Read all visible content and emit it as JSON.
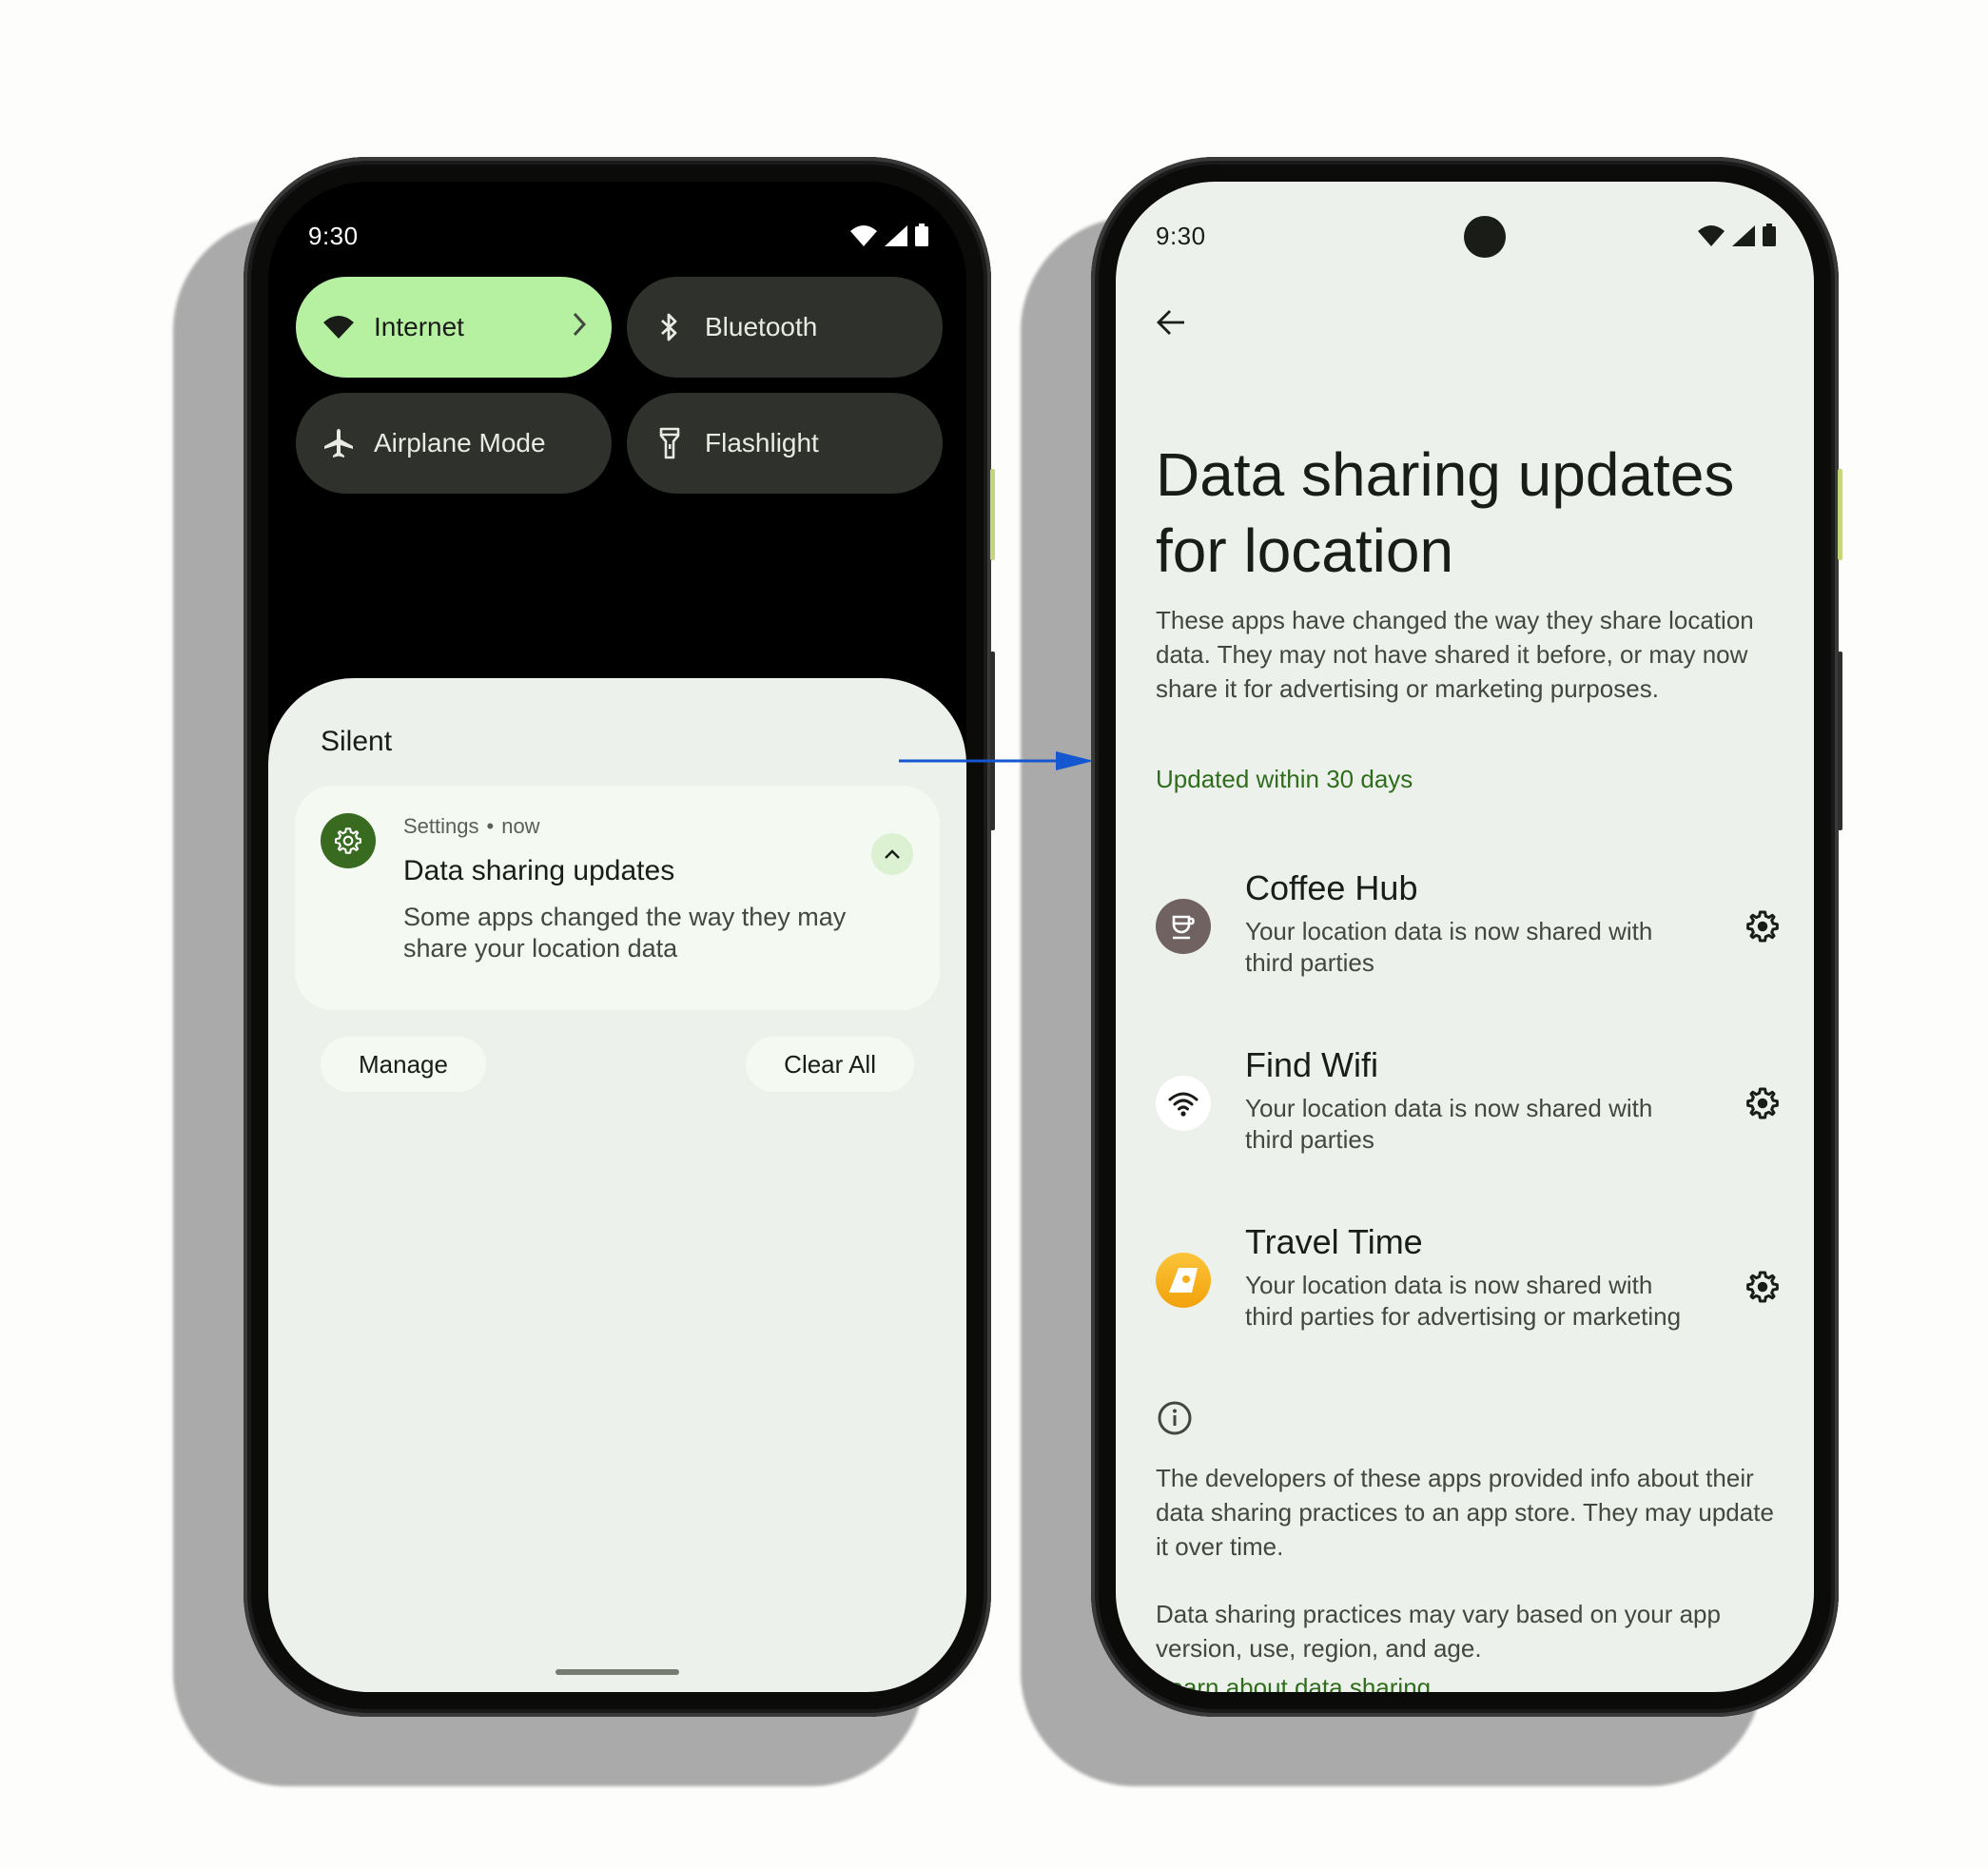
{
  "colors": {
    "accent_green": "#386a20",
    "tile_active": "#b6f0a1",
    "tile_inactive": "#2f312d",
    "surface": "#edf1eb",
    "arrow_blue": "#1557d0"
  },
  "left_phone": {
    "status_bar": {
      "time": "9:30",
      "icons": [
        "wifi-icon",
        "signal-icon",
        "battery-icon"
      ]
    },
    "quick_settings": [
      {
        "label": "Internet",
        "icon": "wifi-icon",
        "active": true,
        "has_chevron": true
      },
      {
        "label": "Bluetooth",
        "icon": "bluetooth-icon",
        "active": false
      },
      {
        "label": "Airplane Mode",
        "icon": "airplane-icon",
        "active": false
      },
      {
        "label": "Flashlight",
        "icon": "flashlight-icon",
        "active": false
      }
    ],
    "shade": {
      "section_title": "Silent",
      "notification": {
        "app": "Settings",
        "separator": "•",
        "time": "now",
        "title": "Data sharing updates",
        "body": "Some apps changed the way they may share your location data",
        "icon": "gear-icon"
      },
      "manage_label": "Manage",
      "clear_all_label": "Clear All"
    }
  },
  "right_phone": {
    "status_bar": {
      "time": "9:30",
      "icons": [
        "wifi-icon",
        "signal-icon",
        "battery-icon"
      ]
    },
    "back_icon": "arrow-back-icon",
    "title": "Data sharing updates for location",
    "description": "These apps have changed the way they share location data. They may not have shared it before, or may now share it for advertising or marketing purposes.",
    "section_label": "Updated within 30 days",
    "apps": [
      {
        "name": "Coffee Hub",
        "description": "Your location data is now shared with third parties",
        "icon": "coffee-cup-icon",
        "icon_color": "#6f6260"
      },
      {
        "name": "Find Wifi",
        "description": "Your location data is now shared with third parties",
        "icon": "wifi-icon",
        "icon_color": "#ffffff"
      },
      {
        "name": "Travel Time",
        "description": "Your location data is now shared with third parties for advertising or marketing",
        "icon": "travel-icon",
        "icon_color": "#f6b01e"
      }
    ],
    "footer": {
      "info_icon": "info-icon",
      "paragraph_1": "The developers of these apps provided info about their data sharing practices to an app store. They may update it over time.",
      "paragraph_2": "Data sharing practices may vary based on your app version, use, region, and age.",
      "link": "Learn about data sharing"
    }
  }
}
